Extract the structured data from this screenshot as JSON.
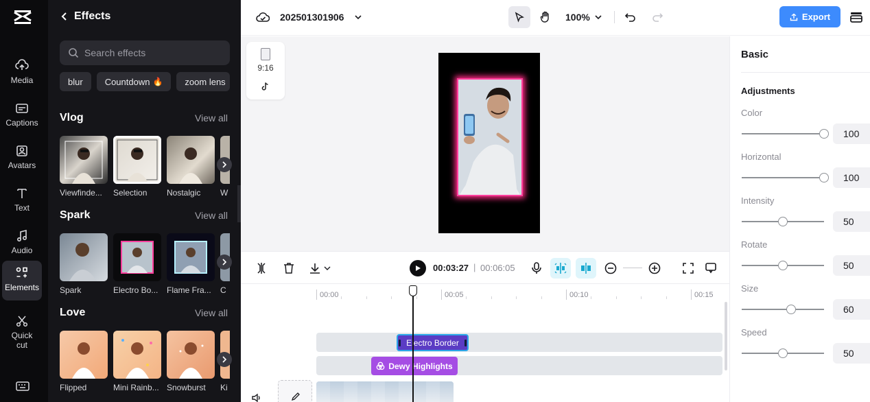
{
  "rail": {
    "items": [
      {
        "label": "Media"
      },
      {
        "label": "Captions"
      },
      {
        "label": "Avatars"
      },
      {
        "label": "Text"
      },
      {
        "label": "Audio"
      },
      {
        "label": "Elements"
      },
      {
        "label": "Quick cut"
      }
    ]
  },
  "panel": {
    "title": "Effects",
    "search_placeholder": "Search effects",
    "chips": [
      {
        "label": "blur"
      },
      {
        "label": "Countdown",
        "fire": "🔥"
      },
      {
        "label": "zoom lens"
      }
    ],
    "sections": [
      {
        "title": "Vlog",
        "view_all": "View all",
        "items": [
          "Viewfinde...",
          "Selection",
          "Nostalgic",
          "W"
        ]
      },
      {
        "title": "Spark",
        "view_all": "View all",
        "items": [
          "Spark",
          "Electro Bo...",
          "Flame Fra...",
          "C"
        ]
      },
      {
        "title": "Love",
        "view_all": "View all",
        "items": [
          "Flipped",
          "Mini Rainb...",
          "Snowburst",
          "Ki"
        ]
      }
    ]
  },
  "topbar": {
    "project_name": "202501301906",
    "zoom": "100%",
    "export_label": "Export"
  },
  "canvas": {
    "ratio": "9:16"
  },
  "properties": {
    "tab": "Basic",
    "heading": "Adjustments",
    "sliders": [
      {
        "label": "Color",
        "value": "100",
        "fraction": 1.0
      },
      {
        "label": "Horizontal",
        "value": "100",
        "fraction": 1.0
      },
      {
        "label": "Intensity",
        "value": "50",
        "fraction": 0.5
      },
      {
        "label": "Rotate",
        "value": "50",
        "fraction": 0.5
      },
      {
        "label": "Size",
        "value": "60",
        "fraction": 0.6
      },
      {
        "label": "Speed",
        "value": "50",
        "fraction": 0.5
      }
    ]
  },
  "timeline": {
    "current_time": "00:03:27",
    "separator": "|",
    "total_time": "00:06:05",
    "ruler": [
      "00:00",
      "00:05",
      "00:10",
      "00:15"
    ],
    "clips": {
      "effect": "Electro Border",
      "filter": "Dewy Highlights"
    }
  },
  "colors": {
    "accent": "#3d8bfd",
    "effect_clip": "#5b3cc4",
    "filter_clip": "#a54de4",
    "neon_border": "#ff3f9d"
  }
}
